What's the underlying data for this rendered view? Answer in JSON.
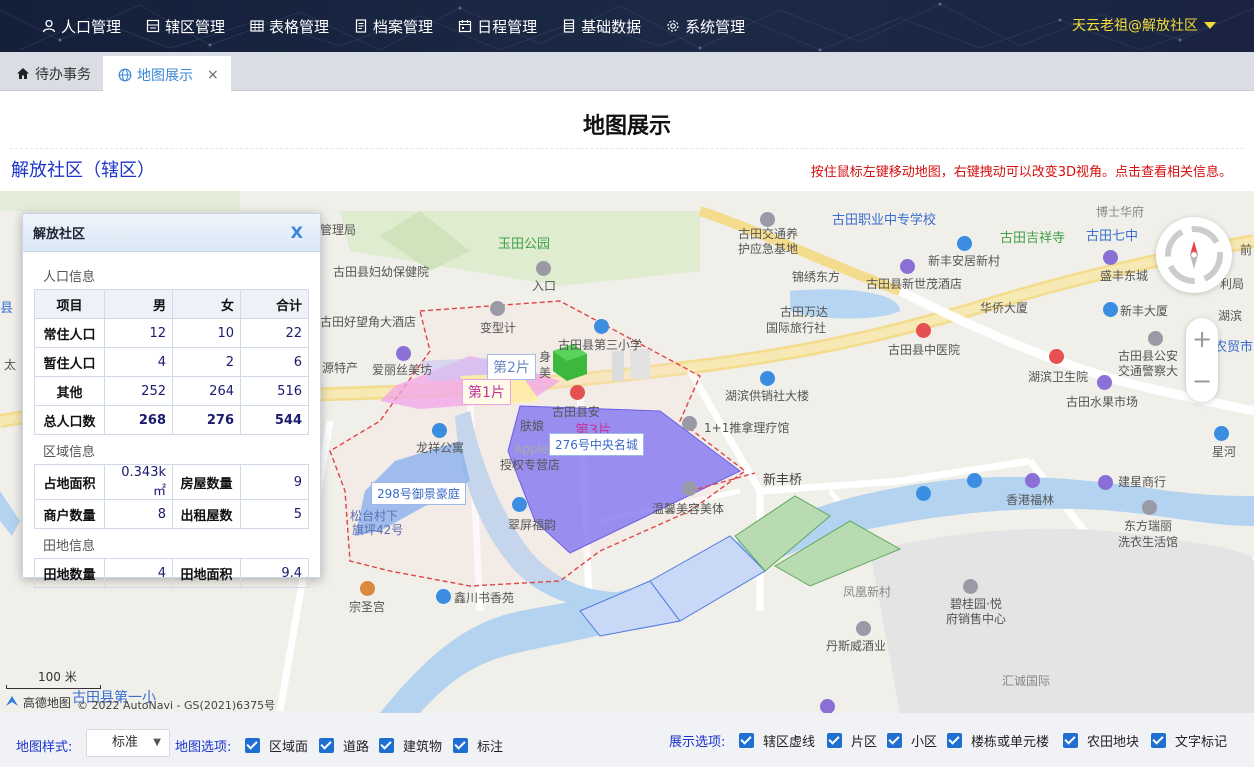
{
  "topbar": {
    "menu": [
      {
        "icon": "user-icon",
        "label": "人口管理"
      },
      {
        "icon": "area-icon",
        "label": "辖区管理"
      },
      {
        "icon": "table-icon",
        "label": "表格管理"
      },
      {
        "icon": "file-icon",
        "label": "档案管理"
      },
      {
        "icon": "calendar-icon",
        "label": "日程管理"
      },
      {
        "icon": "database-icon",
        "label": "基础数据"
      },
      {
        "icon": "gear-icon",
        "label": "系统管理"
      }
    ],
    "user": "天云老祖@解放社区"
  },
  "tabs": [
    {
      "label": "待办事务",
      "icon": "home-icon",
      "active": false
    },
    {
      "label": "地图展示",
      "icon": "globe-icon",
      "active": true,
      "close": "×"
    }
  ],
  "page": {
    "title": "地图展示",
    "district": "解放社区（辖区）",
    "hint": "按住鼠标左键移动地图，右键拽动可以改变3D视角。点击查看相关信息。"
  },
  "info_panel": {
    "title": "解放社区",
    "close": "X",
    "population_section": "人口信息",
    "population_headers": [
      "项目",
      "男",
      "女",
      "合计"
    ],
    "population_rows": [
      {
        "item": "常住人口",
        "male": "12",
        "female": "10",
        "total": "22"
      },
      {
        "item": "暂住人口",
        "male": "4",
        "female": "2",
        "total": "6"
      },
      {
        "item": "其他",
        "male": "252",
        "female": "264",
        "total": "516"
      },
      {
        "item": "总人口数",
        "male": "268",
        "female": "276",
        "total": "544"
      }
    ],
    "area_section": "区域信息",
    "area_rows": [
      {
        "k1": "占地面积",
        "v1": "0.343k㎡",
        "k2": "房屋数量",
        "v2": "9"
      },
      {
        "k1": "商户数量",
        "v1": "8",
        "k2": "出租屋数",
        "v2": "5"
      }
    ],
    "field_section": "田地信息",
    "field_rows": [
      {
        "k1": "田地数量",
        "v1": "4",
        "k2": "田地面积",
        "v2": "9.4"
      }
    ]
  },
  "map": {
    "labels": {
      "l1": "玉田公园",
      "l2": "古田县妇幼保健院",
      "l3": "古田好望角大酒店",
      "l4": "入口",
      "l5": "变型计",
      "l6": "古田县第三小学",
      "l7": "爱丽丝美坊",
      "l8": "源特产",
      "l9": "龙祥公寓",
      "l10": "古田县安",
      "l11": "肤娘",
      "l12": "Apple",
      "l13": "授权专营店",
      "l14": "翠屏福韵",
      "l15": "温馨美容美体",
      "l16": "新丰桥",
      "l17": "1+1推拿理疗馆",
      "l18": "湖滨供销社大楼",
      "l19": "古田万达",
      "l20": "国际旅行社",
      "l21": "古田交通养",
      "l22": "护应急基地",
      "l23": "锦绣东方",
      "l24": "古田县新世茂酒店",
      "l25": "华侨大厦",
      "l26": "古田县中医院",
      "l27": "古田职业中专学校",
      "l28": "古田吉祥寺",
      "l29": "古田七中",
      "l30": "新丰安居新村",
      "l31": "盛丰东城",
      "l32": "新丰大厦",
      "l33": "湖滨卫生院",
      "l34": "古田县公安",
      "l35": "交通警察大",
      "l36": "古田水果市场",
      "l37": "农贸市",
      "l38": "湖滨",
      "l39": "星河",
      "l40": "建星商行",
      "l41": "香港福林",
      "l42": "东方瑞丽",
      "l43": "洗衣生活馆",
      "l44": "凤凰新村",
      "l45": "碧桂园·悦",
      "l46": "府销售中心",
      "l47": "丹斯威酒业",
      "l48": "汇诚国际",
      "l49": "宗圣宫",
      "l50": "鑫川书香苑",
      "l51": "松台村下",
      "l52": "旗坪42号",
      "l53": "管理局",
      "l54": "博士华府",
      "l55": "利局",
      "l56": "前",
      "l57": "身",
      "l58": "美",
      "l59": "太",
      "l60": "县",
      "l61": "古田县第一小",
      "l62": "100 米",
      "l63": "高德地图",
      "l64": "© 2022 AutoNavi - GS(2021)6375号"
    },
    "tags": {
      "pian2": "第2片",
      "pian1": "第1片",
      "pian3": "第3片",
      "community1": "276号中央名城",
      "community2": "298号御景豪庭"
    }
  },
  "bottom": {
    "style_label": "地图样式:",
    "style_value": "标准",
    "map_options_label": "地图选项:",
    "map_options": [
      "区域面",
      "道路",
      "建筑物",
      "标注"
    ],
    "display_label": "展示选项:",
    "display_options": [
      "辖区虚线",
      "片区",
      "小区",
      "楼栋或单元楼",
      "农田地块",
      "文字标记"
    ]
  },
  "colors": {
    "topbar_bg": "#17223a",
    "user_text": "#f2dd3a",
    "accent": "#1f6fd1",
    "hint": "#d60e0e",
    "district": "#1a33cc"
  }
}
